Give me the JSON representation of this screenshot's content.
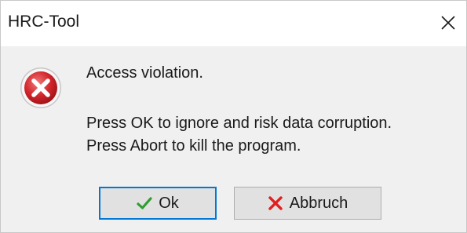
{
  "window": {
    "title": "HRC-Tool",
    "close_icon": "close-icon"
  },
  "message": {
    "icon": "error-icon",
    "line1": "Access violation.",
    "line2": "Press OK to ignore and risk data corruption.",
    "line3": "Press Abort to kill the program."
  },
  "buttons": {
    "ok": {
      "label": "Ok",
      "icon": "check-icon",
      "icon_color": "#2e9e2e"
    },
    "abort": {
      "label": "Abbruch",
      "icon": "x-icon",
      "icon_color": "#e02020"
    }
  },
  "colors": {
    "error_red": "#c4242b",
    "focus_border": "#0078d7"
  }
}
